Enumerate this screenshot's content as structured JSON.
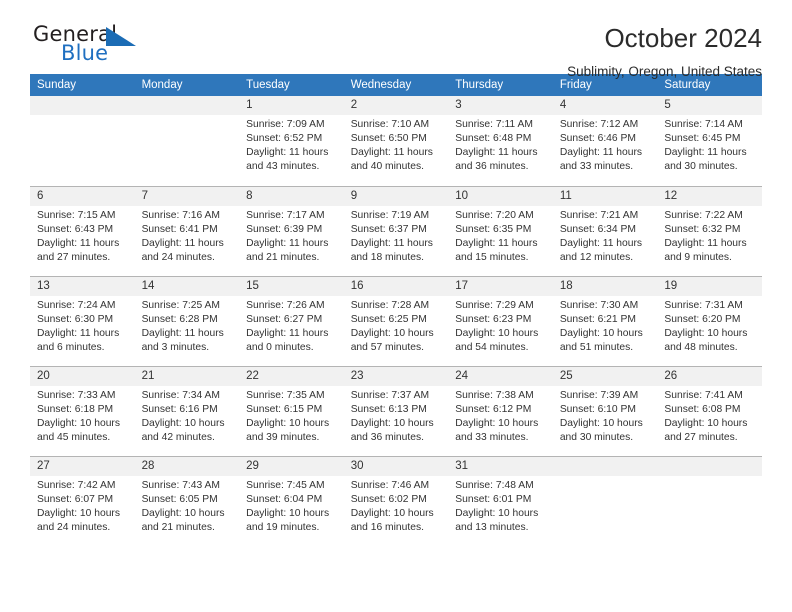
{
  "brand": {
    "word_one": "General",
    "word_two": "Blue",
    "triangle_color": "#1b6cb5",
    "blue_text_color": "#1f6fc0"
  },
  "header": {
    "title": "October 2024",
    "location": "Sublimity, Oregon, United States"
  },
  "calendar": {
    "header_bg": "#2f77bb",
    "daynum_bg": "#f1f1f1",
    "weekdays": [
      "Sunday",
      "Monday",
      "Tuesday",
      "Wednesday",
      "Thursday",
      "Friday",
      "Saturday"
    ],
    "weeks": [
      [
        {
          "day": "",
          "empty": true
        },
        {
          "day": "",
          "empty": true
        },
        {
          "day": "1",
          "sunrise": "Sunrise: 7:09 AM",
          "sunset": "Sunset: 6:52 PM",
          "daylight1": "Daylight: 11 hours",
          "daylight2": "and 43 minutes."
        },
        {
          "day": "2",
          "sunrise": "Sunrise: 7:10 AM",
          "sunset": "Sunset: 6:50 PM",
          "daylight1": "Daylight: 11 hours",
          "daylight2": "and 40 minutes."
        },
        {
          "day": "3",
          "sunrise": "Sunrise: 7:11 AM",
          "sunset": "Sunset: 6:48 PM",
          "daylight1": "Daylight: 11 hours",
          "daylight2": "and 36 minutes."
        },
        {
          "day": "4",
          "sunrise": "Sunrise: 7:12 AM",
          "sunset": "Sunset: 6:46 PM",
          "daylight1": "Daylight: 11 hours",
          "daylight2": "and 33 minutes."
        },
        {
          "day": "5",
          "sunrise": "Sunrise: 7:14 AM",
          "sunset": "Sunset: 6:45 PM",
          "daylight1": "Daylight: 11 hours",
          "daylight2": "and 30 minutes."
        }
      ],
      [
        {
          "day": "6",
          "sunrise": "Sunrise: 7:15 AM",
          "sunset": "Sunset: 6:43 PM",
          "daylight1": "Daylight: 11 hours",
          "daylight2": "and 27 minutes."
        },
        {
          "day": "7",
          "sunrise": "Sunrise: 7:16 AM",
          "sunset": "Sunset: 6:41 PM",
          "daylight1": "Daylight: 11 hours",
          "daylight2": "and 24 minutes."
        },
        {
          "day": "8",
          "sunrise": "Sunrise: 7:17 AM",
          "sunset": "Sunset: 6:39 PM",
          "daylight1": "Daylight: 11 hours",
          "daylight2": "and 21 minutes."
        },
        {
          "day": "9",
          "sunrise": "Sunrise: 7:19 AM",
          "sunset": "Sunset: 6:37 PM",
          "daylight1": "Daylight: 11 hours",
          "daylight2": "and 18 minutes."
        },
        {
          "day": "10",
          "sunrise": "Sunrise: 7:20 AM",
          "sunset": "Sunset: 6:35 PM",
          "daylight1": "Daylight: 11 hours",
          "daylight2": "and 15 minutes."
        },
        {
          "day": "11",
          "sunrise": "Sunrise: 7:21 AM",
          "sunset": "Sunset: 6:34 PM",
          "daylight1": "Daylight: 11 hours",
          "daylight2": "and 12 minutes."
        },
        {
          "day": "12",
          "sunrise": "Sunrise: 7:22 AM",
          "sunset": "Sunset: 6:32 PM",
          "daylight1": "Daylight: 11 hours",
          "daylight2": "and 9 minutes."
        }
      ],
      [
        {
          "day": "13",
          "sunrise": "Sunrise: 7:24 AM",
          "sunset": "Sunset: 6:30 PM",
          "daylight1": "Daylight: 11 hours",
          "daylight2": "and 6 minutes."
        },
        {
          "day": "14",
          "sunrise": "Sunrise: 7:25 AM",
          "sunset": "Sunset: 6:28 PM",
          "daylight1": "Daylight: 11 hours",
          "daylight2": "and 3 minutes."
        },
        {
          "day": "15",
          "sunrise": "Sunrise: 7:26 AM",
          "sunset": "Sunset: 6:27 PM",
          "daylight1": "Daylight: 11 hours",
          "daylight2": "and 0 minutes."
        },
        {
          "day": "16",
          "sunrise": "Sunrise: 7:28 AM",
          "sunset": "Sunset: 6:25 PM",
          "daylight1": "Daylight: 10 hours",
          "daylight2": "and 57 minutes."
        },
        {
          "day": "17",
          "sunrise": "Sunrise: 7:29 AM",
          "sunset": "Sunset: 6:23 PM",
          "daylight1": "Daylight: 10 hours",
          "daylight2": "and 54 minutes."
        },
        {
          "day": "18",
          "sunrise": "Sunrise: 7:30 AM",
          "sunset": "Sunset: 6:21 PM",
          "daylight1": "Daylight: 10 hours",
          "daylight2": "and 51 minutes."
        },
        {
          "day": "19",
          "sunrise": "Sunrise: 7:31 AM",
          "sunset": "Sunset: 6:20 PM",
          "daylight1": "Daylight: 10 hours",
          "daylight2": "and 48 minutes."
        }
      ],
      [
        {
          "day": "20",
          "sunrise": "Sunrise: 7:33 AM",
          "sunset": "Sunset: 6:18 PM",
          "daylight1": "Daylight: 10 hours",
          "daylight2": "and 45 minutes."
        },
        {
          "day": "21",
          "sunrise": "Sunrise: 7:34 AM",
          "sunset": "Sunset: 6:16 PM",
          "daylight1": "Daylight: 10 hours",
          "daylight2": "and 42 minutes."
        },
        {
          "day": "22",
          "sunrise": "Sunrise: 7:35 AM",
          "sunset": "Sunset: 6:15 PM",
          "daylight1": "Daylight: 10 hours",
          "daylight2": "and 39 minutes."
        },
        {
          "day": "23",
          "sunrise": "Sunrise: 7:37 AM",
          "sunset": "Sunset: 6:13 PM",
          "daylight1": "Daylight: 10 hours",
          "daylight2": "and 36 minutes."
        },
        {
          "day": "24",
          "sunrise": "Sunrise: 7:38 AM",
          "sunset": "Sunset: 6:12 PM",
          "daylight1": "Daylight: 10 hours",
          "daylight2": "and 33 minutes."
        },
        {
          "day": "25",
          "sunrise": "Sunrise: 7:39 AM",
          "sunset": "Sunset: 6:10 PM",
          "daylight1": "Daylight: 10 hours",
          "daylight2": "and 30 minutes."
        },
        {
          "day": "26",
          "sunrise": "Sunrise: 7:41 AM",
          "sunset": "Sunset: 6:08 PM",
          "daylight1": "Daylight: 10 hours",
          "daylight2": "and 27 minutes."
        }
      ],
      [
        {
          "day": "27",
          "sunrise": "Sunrise: 7:42 AM",
          "sunset": "Sunset: 6:07 PM",
          "daylight1": "Daylight: 10 hours",
          "daylight2": "and 24 minutes."
        },
        {
          "day": "28",
          "sunrise": "Sunrise: 7:43 AM",
          "sunset": "Sunset: 6:05 PM",
          "daylight1": "Daylight: 10 hours",
          "daylight2": "and 21 minutes."
        },
        {
          "day": "29",
          "sunrise": "Sunrise: 7:45 AM",
          "sunset": "Sunset: 6:04 PM",
          "daylight1": "Daylight: 10 hours",
          "daylight2": "and 19 minutes."
        },
        {
          "day": "30",
          "sunrise": "Sunrise: 7:46 AM",
          "sunset": "Sunset: 6:02 PM",
          "daylight1": "Daylight: 10 hours",
          "daylight2": "and 16 minutes."
        },
        {
          "day": "31",
          "sunrise": "Sunrise: 7:48 AM",
          "sunset": "Sunset: 6:01 PM",
          "daylight1": "Daylight: 10 hours",
          "daylight2": "and 13 minutes."
        },
        {
          "day": "",
          "empty": true
        },
        {
          "day": "",
          "empty": true
        }
      ]
    ]
  }
}
